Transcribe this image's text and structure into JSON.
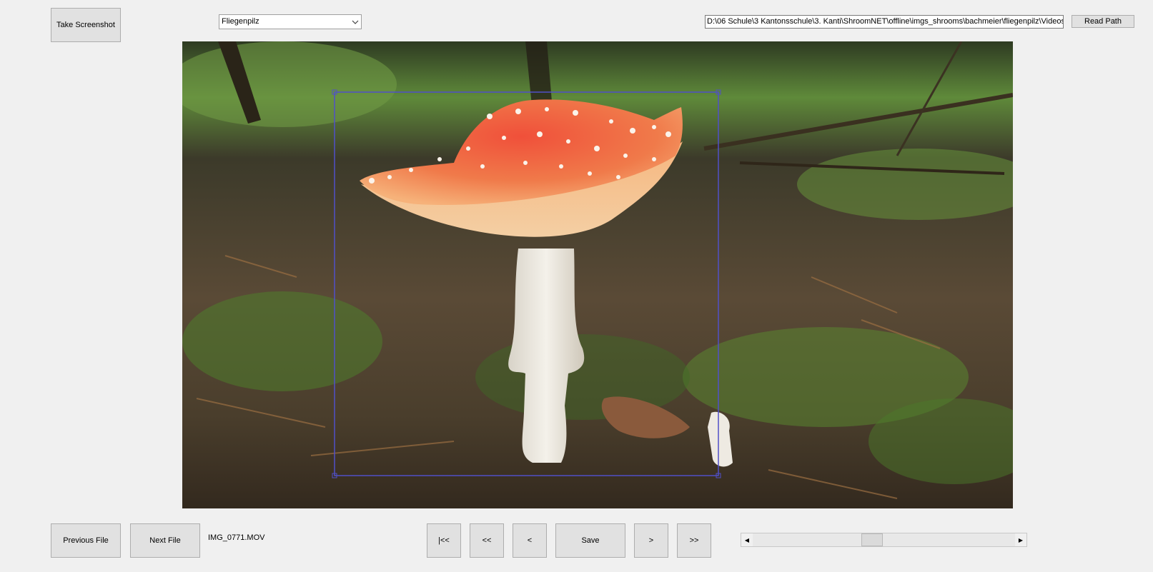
{
  "toolbar": {
    "take_screenshot_label": "Take Screenshot",
    "read_path_label": "Read Path"
  },
  "class_select": {
    "selected": "Fliegenpilz"
  },
  "path": {
    "value": "D:\\06 Schule\\3 Kantonsschule\\3. Kanti\\ShroomNET\\offline\\imgs_shrooms\\bachmeier\\fliegenpilz\\Videos"
  },
  "file_nav": {
    "previous_label": "Previous File",
    "next_label": "Next File",
    "current_file": "IMG_0771.MOV"
  },
  "frame_nav": {
    "first_label": "|<<",
    "back_fast_label": "<<",
    "back_label": "<",
    "save_label": "Save",
    "forward_label": ">",
    "forward_fast_label": ">>"
  },
  "timeline": {
    "position_fraction": 0.45
  },
  "icons": {
    "dropdown": "chevron-down-icon",
    "scroll_left": "triangle-left-icon",
    "scroll_right": "triangle-right-icon"
  },
  "colors": {
    "bounding_box": "#5050c8"
  }
}
